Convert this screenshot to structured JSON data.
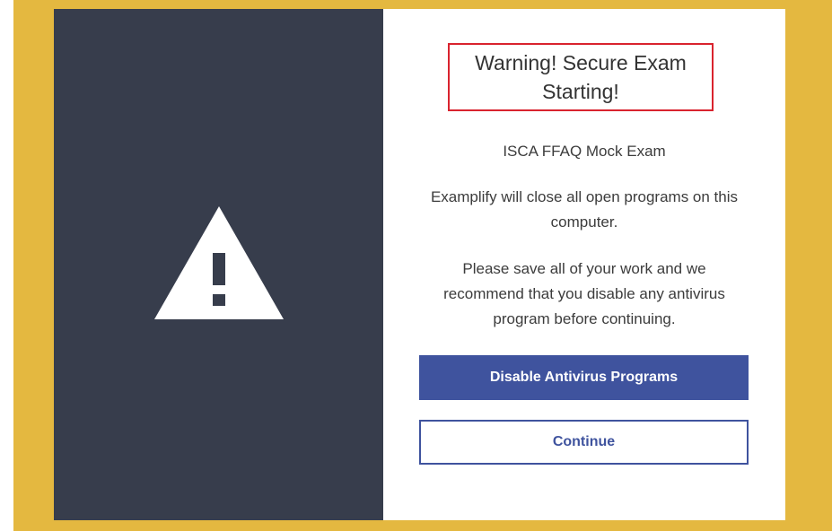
{
  "dialog": {
    "title": "Warning! Secure Exam Starting!",
    "exam_name": "ISCA FFAQ Mock Exam",
    "message_1": "Examplify will close all open programs on this computer.",
    "message_2": "Please save all of your work and we recommend that you disable any antivirus program before continuing.",
    "icon": "warning-triangle-icon"
  },
  "buttons": {
    "disable_antivirus": "Disable Antivirus Programs",
    "continue": "Continue"
  },
  "colors": {
    "frame": "#e4b840",
    "left_panel": "#373d4c",
    "accent": "#3f539e",
    "title_border": "#d9232e"
  }
}
